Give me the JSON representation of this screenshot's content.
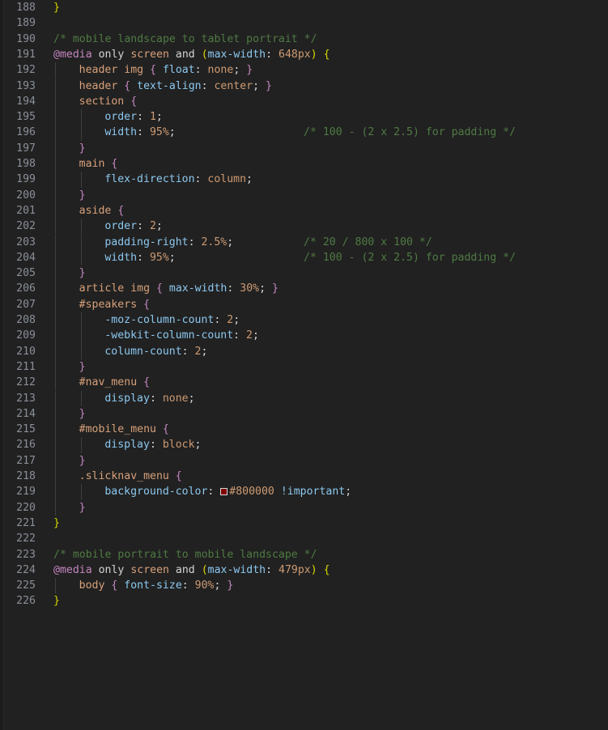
{
  "editor": {
    "theme_name": "dark",
    "background_color": "#212121",
    "gutter_text_color": "#8a8f98",
    "language": "css",
    "first_line_number": 188,
    "last_line_number": 226,
    "colors": {
      "comment": "#4f7a43",
      "at_rule": "#c586c0",
      "selector": "#d7a07a",
      "property": "#8cc8f0",
      "value": "#cd9a72",
      "bracket_level1": "#d7d700",
      "bracket_level2": "#c586c0",
      "plain": "#d4d4d4"
    },
    "inline_color_swatch": {
      "value": "#800000",
      "line": 219
    }
  },
  "lines": [
    {
      "n": "188",
      "indent": 0,
      "guides": 0,
      "tokens": [
        {
          "t": "}",
          "c": "br-y"
        }
      ]
    },
    {
      "n": "189",
      "indent": 0,
      "guides": 0,
      "tokens": []
    },
    {
      "n": "190",
      "indent": 0,
      "guides": 0,
      "tokens": [
        {
          "t": "/* mobile landscape to tablet portrait */",
          "c": "cmt"
        }
      ]
    },
    {
      "n": "191",
      "indent": 0,
      "guides": 0,
      "tokens": [
        {
          "t": "@media",
          "c": "atrule"
        },
        {
          "t": " ",
          "c": "punct"
        },
        {
          "t": "only",
          "c": "kw"
        },
        {
          "t": " ",
          "c": "punct"
        },
        {
          "t": "screen",
          "c": "tag"
        },
        {
          "t": " ",
          "c": "punct"
        },
        {
          "t": "and",
          "c": "kw"
        },
        {
          "t": " ",
          "c": "punct"
        },
        {
          "t": "(",
          "c": "br-b"
        },
        {
          "t": "max-width",
          "c": "prop"
        },
        {
          "t": ": ",
          "c": "punct"
        },
        {
          "t": "648px",
          "c": "val"
        },
        {
          "t": ")",
          "c": "br-b"
        },
        {
          "t": " ",
          "c": "punct"
        },
        {
          "t": "{",
          "c": "br-y"
        }
      ]
    },
    {
      "n": "192",
      "indent": 1,
      "guides": 1,
      "tokens": [
        {
          "t": "header",
          "c": "tag"
        },
        {
          "t": " ",
          "c": "punct"
        },
        {
          "t": "img",
          "c": "tag"
        },
        {
          "t": " ",
          "c": "punct"
        },
        {
          "t": "{",
          "c": "br-p"
        },
        {
          "t": " ",
          "c": "punct"
        },
        {
          "t": "float",
          "c": "prop"
        },
        {
          "t": ": ",
          "c": "punct"
        },
        {
          "t": "none",
          "c": "val"
        },
        {
          "t": ";",
          "c": "punct"
        },
        {
          "t": " ",
          "c": "punct"
        },
        {
          "t": "}",
          "c": "br-p"
        }
      ]
    },
    {
      "n": "193",
      "indent": 1,
      "guides": 1,
      "tokens": [
        {
          "t": "header",
          "c": "tag"
        },
        {
          "t": " ",
          "c": "punct"
        },
        {
          "t": "{",
          "c": "br-p"
        },
        {
          "t": " ",
          "c": "punct"
        },
        {
          "t": "text-align",
          "c": "prop"
        },
        {
          "t": ": ",
          "c": "punct"
        },
        {
          "t": "center",
          "c": "val"
        },
        {
          "t": ";",
          "c": "punct"
        },
        {
          "t": " ",
          "c": "punct"
        },
        {
          "t": "}",
          "c": "br-p"
        }
      ]
    },
    {
      "n": "194",
      "indent": 1,
      "guides": 1,
      "tokens": [
        {
          "t": "section",
          "c": "tag"
        },
        {
          "t": " ",
          "c": "punct"
        },
        {
          "t": "{",
          "c": "br-p"
        }
      ]
    },
    {
      "n": "195",
      "indent": 2,
      "guides": 2,
      "tokens": [
        {
          "t": "order",
          "c": "prop"
        },
        {
          "t": ": ",
          "c": "punct"
        },
        {
          "t": "1",
          "c": "val"
        },
        {
          "t": ";",
          "c": "punct"
        }
      ]
    },
    {
      "n": "196",
      "indent": 2,
      "guides": 2,
      "comment_col": 375,
      "comment": "/* 100 - (2 x 2.5) for padding */",
      "tokens": [
        {
          "t": "width",
          "c": "prop"
        },
        {
          "t": ": ",
          "c": "punct"
        },
        {
          "t": "95%",
          "c": "val"
        },
        {
          "t": ";",
          "c": "punct"
        }
      ]
    },
    {
      "n": "197",
      "indent": 1,
      "guides": 1,
      "tokens": [
        {
          "t": "}",
          "c": "br-p"
        }
      ]
    },
    {
      "n": "198",
      "indent": 1,
      "guides": 1,
      "tokens": [
        {
          "t": "main",
          "c": "tag"
        },
        {
          "t": " ",
          "c": "punct"
        },
        {
          "t": "{",
          "c": "br-p"
        }
      ]
    },
    {
      "n": "199",
      "indent": 2,
      "guides": 2,
      "tokens": [
        {
          "t": "flex-direction",
          "c": "prop"
        },
        {
          "t": ": ",
          "c": "punct"
        },
        {
          "t": "column",
          "c": "val"
        },
        {
          "t": ";",
          "c": "punct"
        }
      ]
    },
    {
      "n": "200",
      "indent": 1,
      "guides": 1,
      "tokens": [
        {
          "t": "}",
          "c": "br-p"
        }
      ]
    },
    {
      "n": "201",
      "indent": 1,
      "guides": 1,
      "tokens": [
        {
          "t": "aside",
          "c": "tag"
        },
        {
          "t": " ",
          "c": "punct"
        },
        {
          "t": "{",
          "c": "br-p"
        }
      ]
    },
    {
      "n": "202",
      "indent": 2,
      "guides": 2,
      "tokens": [
        {
          "t": "order",
          "c": "prop"
        },
        {
          "t": ": ",
          "c": "punct"
        },
        {
          "t": "2",
          "c": "val"
        },
        {
          "t": ";",
          "c": "punct"
        }
      ]
    },
    {
      "n": "203",
      "indent": 2,
      "guides": 2,
      "comment_col": 375,
      "comment": "/* 20 / 800 x 100 */",
      "tokens": [
        {
          "t": "padding-right",
          "c": "prop"
        },
        {
          "t": ": ",
          "c": "punct"
        },
        {
          "t": "2.5%",
          "c": "val"
        },
        {
          "t": ";",
          "c": "punct"
        }
      ]
    },
    {
      "n": "204",
      "indent": 2,
      "guides": 2,
      "comment_col": 375,
      "comment": "/* 100 - (2 x 2.5) for padding */",
      "tokens": [
        {
          "t": "width",
          "c": "prop"
        },
        {
          "t": ": ",
          "c": "punct"
        },
        {
          "t": "95%",
          "c": "val"
        },
        {
          "t": ";",
          "c": "punct"
        }
      ]
    },
    {
      "n": "205",
      "indent": 1,
      "guides": 1,
      "tokens": [
        {
          "t": "}",
          "c": "br-p"
        }
      ]
    },
    {
      "n": "206",
      "indent": 1,
      "guides": 1,
      "tokens": [
        {
          "t": "article",
          "c": "tag"
        },
        {
          "t": " ",
          "c": "punct"
        },
        {
          "t": "img",
          "c": "tag"
        },
        {
          "t": " ",
          "c": "punct"
        },
        {
          "t": "{",
          "c": "br-p"
        },
        {
          "t": " ",
          "c": "punct"
        },
        {
          "t": "max-width",
          "c": "prop"
        },
        {
          "t": ": ",
          "c": "punct"
        },
        {
          "t": "30%",
          "c": "val"
        },
        {
          "t": ";",
          "c": "punct"
        },
        {
          "t": " ",
          "c": "punct"
        },
        {
          "t": "}",
          "c": "br-p"
        }
      ]
    },
    {
      "n": "207",
      "indent": 1,
      "guides": 1,
      "tokens": [
        {
          "t": "#speakers",
          "c": "id"
        },
        {
          "t": " ",
          "c": "punct"
        },
        {
          "t": "{",
          "c": "br-p"
        }
      ]
    },
    {
      "n": "208",
      "indent": 2,
      "guides": 2,
      "tokens": [
        {
          "t": "-moz-column-count",
          "c": "prop"
        },
        {
          "t": ": ",
          "c": "punct"
        },
        {
          "t": "2",
          "c": "val"
        },
        {
          "t": ";",
          "c": "punct"
        }
      ]
    },
    {
      "n": "209",
      "indent": 2,
      "guides": 2,
      "tokens": [
        {
          "t": "-webkit-column-count",
          "c": "prop"
        },
        {
          "t": ": ",
          "c": "punct"
        },
        {
          "t": "2",
          "c": "val"
        },
        {
          "t": ";",
          "c": "punct"
        }
      ]
    },
    {
      "n": "210",
      "indent": 2,
      "guides": 2,
      "tokens": [
        {
          "t": "column-count",
          "c": "prop"
        },
        {
          "t": ": ",
          "c": "punct"
        },
        {
          "t": "2",
          "c": "val"
        },
        {
          "t": ";",
          "c": "punct"
        }
      ]
    },
    {
      "n": "211",
      "indent": 1,
      "guides": 1,
      "tokens": [
        {
          "t": "}",
          "c": "br-p"
        }
      ]
    },
    {
      "n": "212",
      "indent": 1,
      "guides": 1,
      "tokens": [
        {
          "t": "#nav_menu",
          "c": "id"
        },
        {
          "t": " ",
          "c": "punct"
        },
        {
          "t": "{",
          "c": "br-p"
        }
      ]
    },
    {
      "n": "213",
      "indent": 2,
      "guides": 2,
      "tokens": [
        {
          "t": "display",
          "c": "prop"
        },
        {
          "t": ": ",
          "c": "punct"
        },
        {
          "t": "none",
          "c": "val"
        },
        {
          "t": ";",
          "c": "punct"
        }
      ]
    },
    {
      "n": "214",
      "indent": 1,
      "guides": 1,
      "tokens": [
        {
          "t": "}",
          "c": "br-p"
        }
      ]
    },
    {
      "n": "215",
      "indent": 1,
      "guides": 1,
      "tokens": [
        {
          "t": "#mobile_menu",
          "c": "id"
        },
        {
          "t": " ",
          "c": "punct"
        },
        {
          "t": "{",
          "c": "br-p"
        }
      ]
    },
    {
      "n": "216",
      "indent": 2,
      "guides": 2,
      "tokens": [
        {
          "t": "display",
          "c": "prop"
        },
        {
          "t": ": ",
          "c": "punct"
        },
        {
          "t": "block",
          "c": "val"
        },
        {
          "t": ";",
          "c": "punct"
        }
      ]
    },
    {
      "n": "217",
      "indent": 1,
      "guides": 1,
      "tokens": [
        {
          "t": "}",
          "c": "br-p"
        }
      ]
    },
    {
      "n": "218",
      "indent": 1,
      "guides": 1,
      "tokens": [
        {
          "t": ".slicknav_menu",
          "c": "cls"
        },
        {
          "t": " ",
          "c": "punct"
        },
        {
          "t": "{",
          "c": "br-p"
        }
      ]
    },
    {
      "n": "219",
      "indent": 2,
      "guides": 2,
      "swatch": "#800000",
      "tokens": [
        {
          "t": "background-color",
          "c": "prop"
        },
        {
          "t": ": ",
          "c": "punct"
        },
        {
          "t": "SWATCH",
          "c": "swatch"
        },
        {
          "t": "#800000",
          "c": "val"
        },
        {
          "t": " ",
          "c": "punct"
        },
        {
          "t": "!important",
          "c": "imp"
        },
        {
          "t": ";",
          "c": "punct"
        }
      ]
    },
    {
      "n": "220",
      "indent": 1,
      "guides": 1,
      "tokens": [
        {
          "t": "}",
          "c": "br-p"
        }
      ]
    },
    {
      "n": "221",
      "indent": 0,
      "guides": 0,
      "tokens": [
        {
          "t": "}",
          "c": "br-y"
        }
      ]
    },
    {
      "n": "222",
      "indent": 0,
      "guides": 0,
      "tokens": []
    },
    {
      "n": "223",
      "indent": 0,
      "guides": 0,
      "tokens": [
        {
          "t": "/* mobile portrait to mobile landscape */",
          "c": "cmt"
        }
      ]
    },
    {
      "n": "224",
      "indent": 0,
      "guides": 0,
      "tokens": [
        {
          "t": "@media",
          "c": "atrule"
        },
        {
          "t": " ",
          "c": "punct"
        },
        {
          "t": "only",
          "c": "kw"
        },
        {
          "t": " ",
          "c": "punct"
        },
        {
          "t": "screen",
          "c": "tag"
        },
        {
          "t": " ",
          "c": "punct"
        },
        {
          "t": "and",
          "c": "kw"
        },
        {
          "t": " ",
          "c": "punct"
        },
        {
          "t": "(",
          "c": "br-b"
        },
        {
          "t": "max-width",
          "c": "prop"
        },
        {
          "t": ": ",
          "c": "punct"
        },
        {
          "t": "479px",
          "c": "val"
        },
        {
          "t": ")",
          "c": "br-b"
        },
        {
          "t": " ",
          "c": "punct"
        },
        {
          "t": "{",
          "c": "br-y"
        }
      ]
    },
    {
      "n": "225",
      "indent": 1,
      "guides": 1,
      "tokens": [
        {
          "t": "body",
          "c": "tag"
        },
        {
          "t": " ",
          "c": "punct"
        },
        {
          "t": "{",
          "c": "br-p"
        },
        {
          "t": " ",
          "c": "punct"
        },
        {
          "t": "font-size",
          "c": "prop"
        },
        {
          "t": ": ",
          "c": "punct"
        },
        {
          "t": "90%",
          "c": "val"
        },
        {
          "t": ";",
          "c": "punct"
        },
        {
          "t": " ",
          "c": "punct"
        },
        {
          "t": "}",
          "c": "br-p"
        }
      ]
    },
    {
      "n": "226",
      "indent": 0,
      "guides": 0,
      "tokens": [
        {
          "t": "}",
          "c": "br-y"
        }
      ]
    }
  ]
}
